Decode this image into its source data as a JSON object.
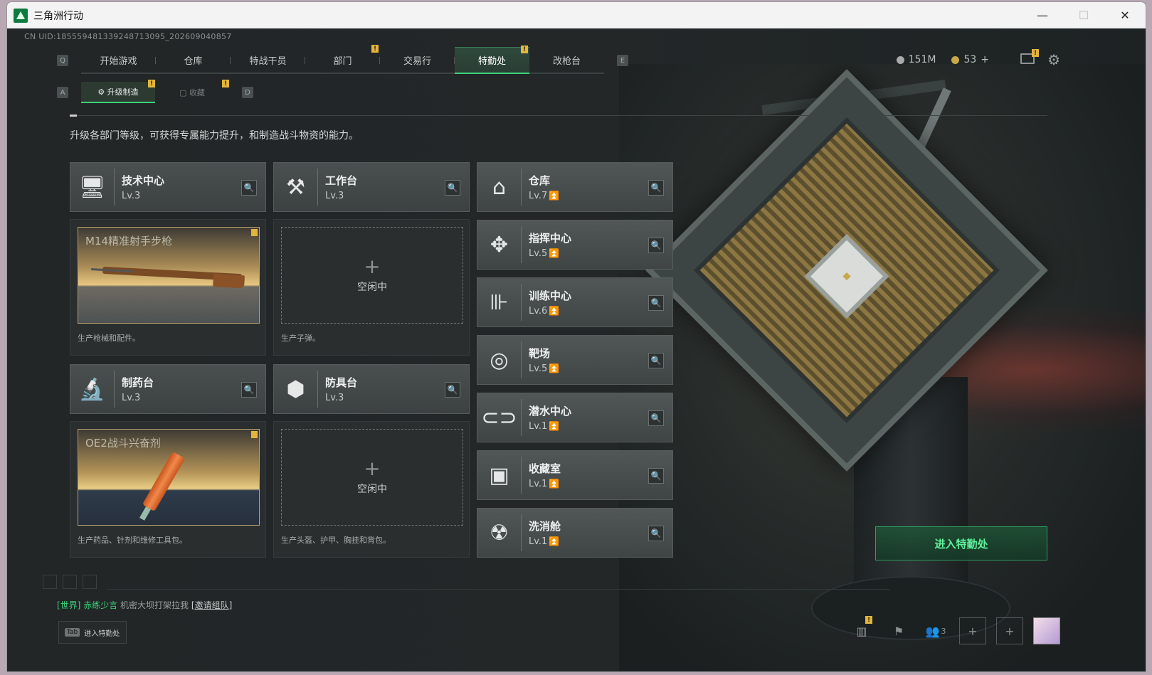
{
  "window": {
    "title": "三角洲行动",
    "minimize": "—",
    "maximize": "☐",
    "close": "✕"
  },
  "uid": "CN UID:185559481339248713095_202609040857",
  "tabs": [
    {
      "label": "开始游戏"
    },
    {
      "label": "仓库"
    },
    {
      "label": "特战干员"
    },
    {
      "label": "部门"
    },
    {
      "label": "交易行"
    },
    {
      "label": "特勤处"
    },
    {
      "label": "改枪台"
    }
  ],
  "keyhints": {
    "left": "Q",
    "right": "E",
    "sub_left": "A",
    "sub_right": "D"
  },
  "currency": {
    "silver": "151M",
    "gold": "53",
    "add": "+"
  },
  "subtabs": [
    {
      "label": "升级制造"
    },
    {
      "label": "收藏"
    }
  ],
  "intro": "升级各部门等级，可获得专属能力提升，和制造战斗物资的能力。",
  "left_cards": [
    {
      "name": "技术中心",
      "level": "Lv.3",
      "icon": "monitor-icon"
    },
    {
      "name": "工作台",
      "level": "Lv.3",
      "icon": "tools-icon"
    },
    {
      "name": "制药台",
      "level": "Lv.3",
      "icon": "microscope-icon"
    },
    {
      "name": "防具台",
      "level": "Lv.3",
      "icon": "armor-icon"
    }
  ],
  "panels": [
    {
      "product": "M14精准射手步枪",
      "desc": "生产枪械和配件。"
    },
    {
      "empty": "空闲中",
      "plus": "+",
      "desc": "生产子弹。"
    },
    {
      "product": "OE2战斗兴奋剂",
      "desc": "生产药品、针剂和维修工具包。"
    },
    {
      "empty": "空闲中",
      "plus": "+",
      "desc": "生产头盔、护甲、胸挂和背包。"
    }
  ],
  "right_cards": [
    {
      "name": "仓库",
      "level": "Lv.7",
      "icon": "storage-icon"
    },
    {
      "name": "指挥中心",
      "level": "Lv.5",
      "icon": "command-icon"
    },
    {
      "name": "训练中心",
      "level": "Lv.6",
      "icon": "dumbbell-icon"
    },
    {
      "name": "靶场",
      "level": "Lv.5",
      "icon": "target-icon"
    },
    {
      "name": "潜水中心",
      "level": "Lv.1",
      "icon": "diving-mask-icon"
    },
    {
      "name": "收藏室",
      "level": "Lv.1",
      "icon": "collection-icon"
    },
    {
      "name": "洗消舱",
      "level": "Lv.1",
      "icon": "decon-icon"
    }
  ],
  "enter_button": "进入特勤处",
  "chat": {
    "channel": "[世界]",
    "user": "赤练少言",
    "message": "机密大坝打架拉我",
    "link": "[邀请组队]"
  },
  "tab_hint": {
    "key": "Tab",
    "label": "进入特勤处"
  },
  "bottom": {
    "friends_count": "3"
  },
  "colors": {
    "accent": "#3bd27a",
    "badge": "#e3b53d",
    "bg": "#232728"
  }
}
